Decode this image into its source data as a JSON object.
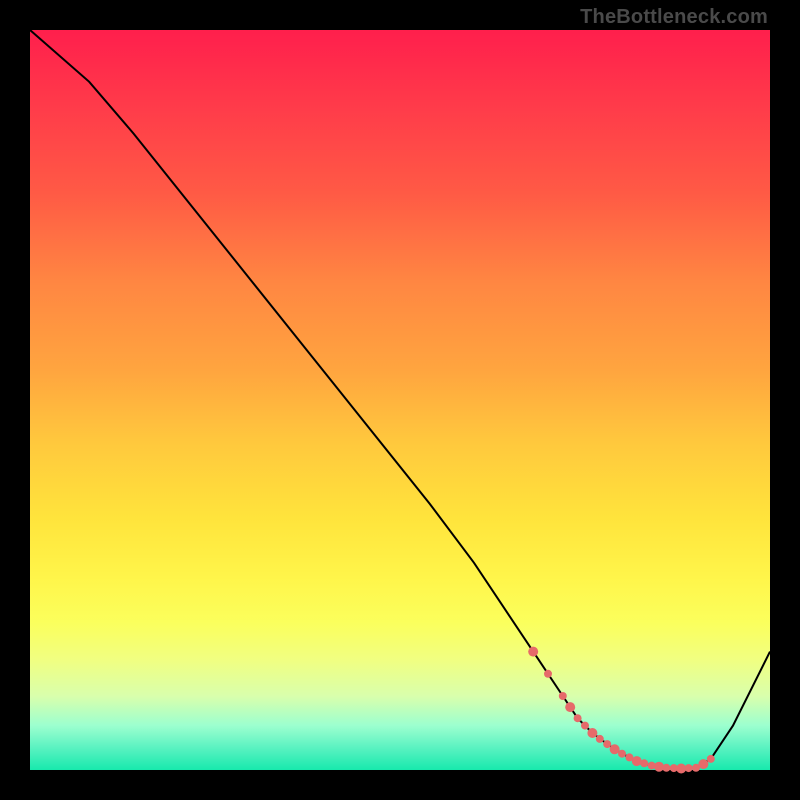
{
  "attribution": "TheBottleneck.com",
  "colors": {
    "bg": "#000000",
    "gradient_top": "#ff1f4c",
    "gradient_mid1": "#ffa53f",
    "gradient_mid2": "#fff54a",
    "gradient_bottom": "#17e9ad",
    "curve": "#000000",
    "marker": "#e66a6a"
  },
  "chart_data": {
    "type": "line",
    "title": "",
    "xlabel": "",
    "ylabel": "",
    "xlim": [
      0,
      100
    ],
    "ylim": [
      0,
      100
    ],
    "grid": false,
    "legend": false,
    "series": [
      {
        "name": "curve",
        "x": [
          0,
          8,
          14,
          22,
          30,
          38,
          46,
          54,
          60,
          64,
          68,
          70,
          72,
          74,
          76,
          78,
          80,
          82,
          84,
          86,
          88,
          90,
          92,
          95,
          100
        ],
        "values": [
          100,
          93,
          86,
          76,
          66,
          56,
          46,
          36,
          28,
          22,
          16,
          13,
          10,
          7,
          5,
          3.5,
          2.2,
          1.2,
          0.6,
          0.3,
          0.2,
          0.3,
          1.5,
          6,
          16
        ]
      }
    ],
    "markers": {
      "name": "flat-region",
      "x": [
        68,
        70,
        72,
        73,
        74,
        75,
        76,
        77,
        78,
        79,
        80,
        81,
        82,
        83,
        84,
        85,
        86,
        87,
        88,
        89,
        90,
        91,
        92
      ],
      "values": [
        16,
        13,
        10,
        8.5,
        7,
        6,
        5,
        4.2,
        3.5,
        2.8,
        2.2,
        1.7,
        1.2,
        0.9,
        0.6,
        0.45,
        0.3,
        0.25,
        0.2,
        0.25,
        0.3,
        0.8,
        1.5
      ]
    }
  }
}
